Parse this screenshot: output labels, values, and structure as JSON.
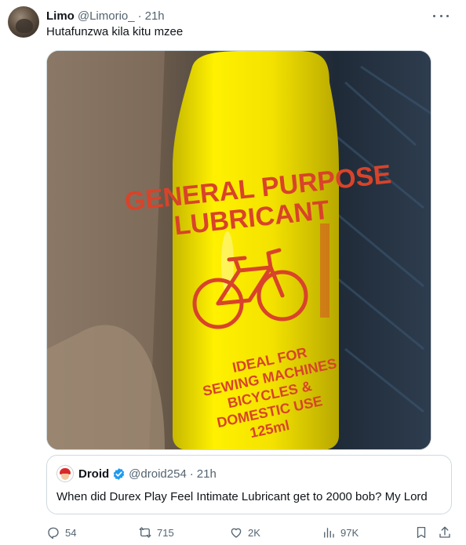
{
  "tweet": {
    "author_name": "Limo",
    "author_handle": "@Limorio_",
    "separator": "·",
    "time": "21h",
    "text": "Hutafunzwa kila kitu mzee"
  },
  "media": {
    "label_line1": "GENERAL PURPOSE",
    "label_line2": "LUBRICANT",
    "uses_line1": "IDEAL FOR",
    "uses_line2": "SEWING MACHINES",
    "uses_line3": "BICYCLES &",
    "uses_line4": "DOMESTIC USE",
    "volume": "125ml"
  },
  "quote": {
    "author_name": "Droid",
    "author_handle": "@droid254",
    "separator": "·",
    "time": "21h",
    "text": "When did Durex Play Feel Intimate Lubricant get to 2000 bob? My Lord"
  },
  "actions": {
    "replies": "54",
    "reposts": "715",
    "likes": "2K",
    "views": "97K"
  },
  "colors": {
    "verified": "#1d9bf0",
    "secondary_text": "#536471",
    "bottle_yellow": "#f5e400",
    "label_red": "#d8432a"
  }
}
